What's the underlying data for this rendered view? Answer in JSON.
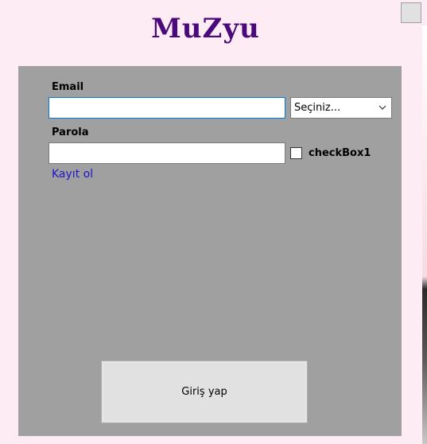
{
  "window": {
    "close_icon": "close-icon"
  },
  "brand": {
    "logo_text": "MuZyu",
    "color": "#4b0a7c"
  },
  "form": {
    "email_label": "Email",
    "email_value": "",
    "select": {
      "selected": "Seçiniz..."
    },
    "password_label": "Parola",
    "password_value": "",
    "checkbox": {
      "label": "checkBox1",
      "checked": false
    },
    "register_link": "Kayıt ol",
    "submit_label": "Giriş yap"
  },
  "colors": {
    "background": "#fdecf3",
    "panel": "#a0a0a0",
    "link": "#1e14c8",
    "focus_border": "#0078d7"
  }
}
